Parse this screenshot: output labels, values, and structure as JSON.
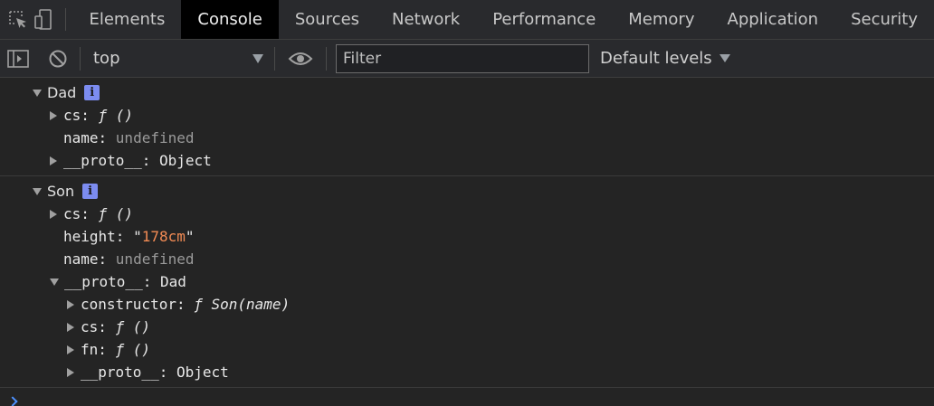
{
  "tabs": [
    {
      "label": "Elements",
      "active": false
    },
    {
      "label": "Console",
      "active": true
    },
    {
      "label": "Sources",
      "active": false
    },
    {
      "label": "Network",
      "active": false
    },
    {
      "label": "Performance",
      "active": false
    },
    {
      "label": "Memory",
      "active": false
    },
    {
      "label": "Application",
      "active": false
    },
    {
      "label": "Security",
      "active": false
    }
  ],
  "toolbar": {
    "context": "top",
    "filter_placeholder": "Filter",
    "levels_label": "Default levels"
  },
  "console": {
    "dad": {
      "label": "Dad",
      "info": "i",
      "cs": {
        "key": "cs",
        "sep": ": ",
        "value": "ƒ ()"
      },
      "name": {
        "key": "name",
        "sep": ": ",
        "value": "undefined"
      },
      "proto": {
        "key": "__proto__",
        "sep": ": ",
        "value": "Object"
      }
    },
    "son": {
      "label": "Son",
      "info": "i",
      "cs": {
        "key": "cs",
        "sep": ": ",
        "value": "ƒ ()"
      },
      "height": {
        "key": "height",
        "sep": ": ",
        "quote": "\"",
        "value": "178cm"
      },
      "name": {
        "key": "name",
        "sep": ": ",
        "value": "undefined"
      },
      "proto": {
        "key": "__proto__",
        "sep": ": ",
        "value": "Dad",
        "constructor": {
          "key": "constructor",
          "sep": ": ",
          "value": "ƒ Son(name)"
        },
        "cs": {
          "key": "cs",
          "sep": ": ",
          "value": "ƒ ()"
        },
        "fn": {
          "key": "fn",
          "sep": ": ",
          "value": "ƒ ()"
        },
        "proto": {
          "key": "__proto__",
          "sep": ": ",
          "value": "Object"
        }
      }
    }
  },
  "colors": {
    "background": "#242424",
    "toolbar": "#292a2d",
    "active_tab": "#000000",
    "string": "#f28b54",
    "info_badge": "#7c8cf0",
    "prompt": "#4d90fe"
  },
  "icons": [
    "inspect-element-icon",
    "device-toolbar-icon",
    "sidebar-toggle-icon",
    "clear-console-icon",
    "live-expression-eye-icon",
    "prompt-chevron-icon"
  ]
}
